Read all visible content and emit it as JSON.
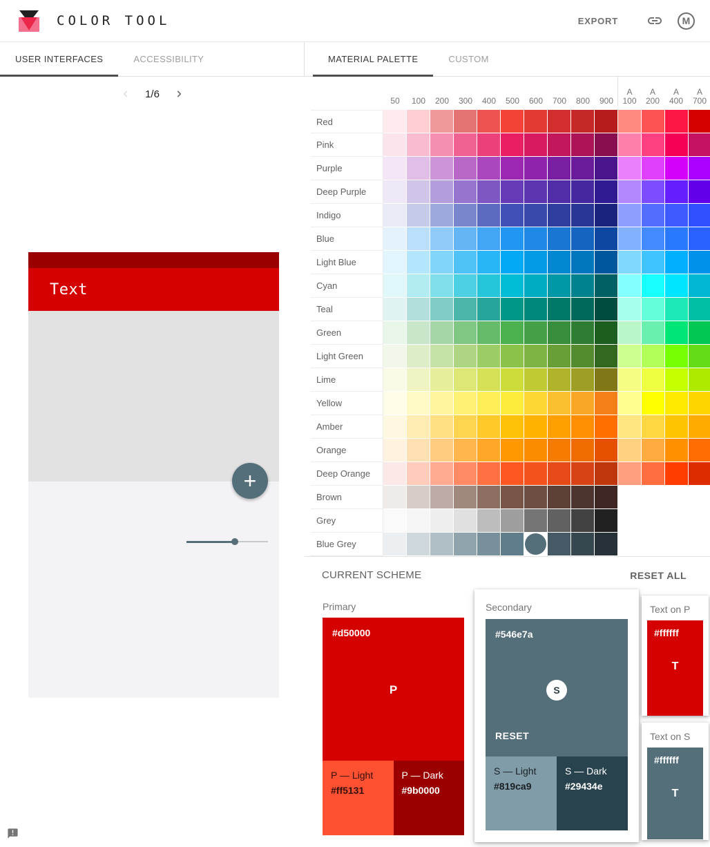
{
  "header": {
    "title": "COLOR TOOL",
    "export_label": "EXPORT",
    "avatar_letter": "M"
  },
  "tabs": {
    "left": [
      {
        "label": "USER INTERFACES",
        "active": true
      },
      {
        "label": "ACCESSIBILITY",
        "active": false
      }
    ],
    "right": [
      {
        "label": "MATERIAL PALETTE",
        "active": true
      },
      {
        "label": "CUSTOM",
        "active": false
      }
    ]
  },
  "preview": {
    "pagination": {
      "current": "1/6",
      "prev_enabled": false,
      "next_enabled": true
    },
    "toolbar_text": "Text",
    "fab_glyph": "+",
    "slider_percent": 59,
    "colors": {
      "status_bar": "#9b0000",
      "app_bar": "#d50000",
      "content_top": "#e2e2e3",
      "content_bottom": "#f3f3f5",
      "fab": "#546e7a",
      "slider": "#546e7a"
    }
  },
  "palette": {
    "columns": [
      "50",
      "100",
      "200",
      "300",
      "400",
      "500",
      "600",
      "700",
      "800",
      "900",
      "A 100",
      "A 200",
      "A 400",
      "A 700"
    ],
    "selected": {
      "row": "Blue Grey",
      "column": "600"
    },
    "rows": [
      {
        "name": "Red",
        "colors": [
          "#ffebee",
          "#ffcdd2",
          "#ef9a9a",
          "#e57373",
          "#ef5350",
          "#f44336",
          "#e53935",
          "#d32f2f",
          "#c62828",
          "#b71c1c",
          "#ff8a80",
          "#ff5252",
          "#ff1744",
          "#d50000"
        ]
      },
      {
        "name": "Pink",
        "colors": [
          "#fce4ec",
          "#f8bbd0",
          "#f48fb1",
          "#f06292",
          "#ec407a",
          "#e91e63",
          "#d81b60",
          "#c2185b",
          "#ad1457",
          "#880e4f",
          "#ff80ab",
          "#ff4081",
          "#f50057",
          "#c51162"
        ]
      },
      {
        "name": "Purple",
        "colors": [
          "#f3e5f5",
          "#e1bee7",
          "#ce93d8",
          "#ba68c8",
          "#ab47bc",
          "#9c27b0",
          "#8e24aa",
          "#7b1fa2",
          "#6a1b9a",
          "#4a148c",
          "#ea80fc",
          "#e040fb",
          "#d500f9",
          "#aa00ff"
        ]
      },
      {
        "name": "Deep Purple",
        "colors": [
          "#ede7f6",
          "#d1c4e9",
          "#b39ddb",
          "#9575cd",
          "#7e57c2",
          "#673ab7",
          "#5e35b1",
          "#512da8",
          "#4527a0",
          "#311b92",
          "#b388ff",
          "#7c4dff",
          "#651fff",
          "#6200ea"
        ]
      },
      {
        "name": "Indigo",
        "colors": [
          "#e8eaf6",
          "#c5cae9",
          "#9fa8da",
          "#7986cb",
          "#5c6bc0",
          "#3f51b5",
          "#3949ab",
          "#303f9f",
          "#283593",
          "#1a237e",
          "#8c9eff",
          "#536dfe",
          "#3d5afe",
          "#304ffe"
        ]
      },
      {
        "name": "Blue",
        "colors": [
          "#e3f2fd",
          "#bbdefb",
          "#90caf9",
          "#64b5f6",
          "#42a5f5",
          "#2196f3",
          "#1e88e5",
          "#1976d2",
          "#1565c0",
          "#0d47a1",
          "#82b1ff",
          "#448aff",
          "#2979ff",
          "#2962ff"
        ]
      },
      {
        "name": "Light Blue",
        "colors": [
          "#e1f5fe",
          "#b3e5fc",
          "#81d4fa",
          "#4fc3f7",
          "#29b6f6",
          "#03a9f4",
          "#039be5",
          "#0288d1",
          "#0277bd",
          "#01579b",
          "#80d8ff",
          "#40c4ff",
          "#00b0ff",
          "#0091ea"
        ]
      },
      {
        "name": "Cyan",
        "colors": [
          "#e0f7fa",
          "#b2ebf2",
          "#80deea",
          "#4dd0e1",
          "#26c6da",
          "#00bcd4",
          "#00acc1",
          "#0097a7",
          "#00838f",
          "#006064",
          "#84ffff",
          "#18ffff",
          "#00e5ff",
          "#00b8d4"
        ]
      },
      {
        "name": "Teal",
        "colors": [
          "#e0f2f1",
          "#b2dfdb",
          "#80cbc4",
          "#4db6ac",
          "#26a69a",
          "#009688",
          "#00897b",
          "#00796b",
          "#00695c",
          "#004d40",
          "#a7ffeb",
          "#64ffda",
          "#1de9b6",
          "#00bfa5"
        ]
      },
      {
        "name": "Green",
        "colors": [
          "#e8f5e9",
          "#c8e6c9",
          "#a5d6a7",
          "#81c784",
          "#66bb6a",
          "#4caf50",
          "#43a047",
          "#388e3c",
          "#2e7d32",
          "#1b5e20",
          "#b9f6ca",
          "#69f0ae",
          "#00e676",
          "#00c853"
        ]
      },
      {
        "name": "Light Green",
        "colors": [
          "#f1f8e9",
          "#dcedc8",
          "#c5e1a5",
          "#aed581",
          "#9ccc65",
          "#8bc34a",
          "#7cb342",
          "#689f38",
          "#558b2f",
          "#33691e",
          "#ccff90",
          "#b2ff59",
          "#76ff03",
          "#64dd17"
        ]
      },
      {
        "name": "Lime",
        "colors": [
          "#f9fbe7",
          "#f0f4c3",
          "#e6ee9c",
          "#dce775",
          "#d4e157",
          "#cddc39",
          "#c0ca33",
          "#afb42b",
          "#9e9d24",
          "#827717",
          "#f4ff81",
          "#eeff41",
          "#c6ff00",
          "#aeea00"
        ]
      },
      {
        "name": "Yellow",
        "colors": [
          "#fffde7",
          "#fff9c4",
          "#fff59d",
          "#fff176",
          "#ffee58",
          "#ffeb3b",
          "#fdd835",
          "#fbc02d",
          "#f9a825",
          "#f57f17",
          "#ffff8d",
          "#ffff00",
          "#ffea00",
          "#ffd600"
        ]
      },
      {
        "name": "Amber",
        "colors": [
          "#fff8e1",
          "#ffecb3",
          "#ffe082",
          "#ffd54f",
          "#ffca28",
          "#ffc107",
          "#ffb300",
          "#ffa000",
          "#ff8f00",
          "#ff6f00",
          "#ffe57f",
          "#ffd740",
          "#ffc400",
          "#ffab00"
        ]
      },
      {
        "name": "Orange",
        "colors": [
          "#fff3e0",
          "#ffe0b2",
          "#ffcc80",
          "#ffb74d",
          "#ffa726",
          "#ff9800",
          "#fb8c00",
          "#f57c00",
          "#ef6c00",
          "#e65100",
          "#ffd180",
          "#ffab40",
          "#ff9100",
          "#ff6d00"
        ]
      },
      {
        "name": "Deep Orange",
        "colors": [
          "#fbe9e7",
          "#ffccbc",
          "#ffab91",
          "#ff8a65",
          "#ff7043",
          "#ff5722",
          "#f4511e",
          "#e64a19",
          "#d84315",
          "#bf360c",
          "#ff9e80",
          "#ff6e40",
          "#ff3d00",
          "#dd2c00"
        ]
      },
      {
        "name": "Brown",
        "colors": [
          "#efebe9",
          "#d7ccc8",
          "#bcaaa4",
          "#a1887f",
          "#8d6e63",
          "#795548",
          "#6d4c41",
          "#5d4037",
          "#4e342e",
          "#3e2723"
        ]
      },
      {
        "name": "Grey",
        "colors": [
          "#fafafa",
          "#f5f5f5",
          "#eeeeee",
          "#e0e0e0",
          "#bdbdbd",
          "#9e9e9e",
          "#757575",
          "#616161",
          "#424242",
          "#212121"
        ]
      },
      {
        "name": "Blue Grey",
        "colors": [
          "#eceff1",
          "#cfd8dc",
          "#b0bec5",
          "#90a4ae",
          "#78909c",
          "#607d8b",
          "#546e7a",
          "#455a64",
          "#37474f",
          "#263238"
        ]
      }
    ]
  },
  "scheme": {
    "title": "CURRENT SCHEME",
    "reset_all": "RESET ALL",
    "primary": {
      "label": "Primary",
      "hex": "#d50000",
      "letter": "P",
      "light": {
        "label": "P — Light",
        "hex": "#ff5131"
      },
      "dark": {
        "label": "P — Dark",
        "hex": "#9b0000"
      }
    },
    "secondary": {
      "label": "Secondary",
      "hex": "#546e7a",
      "letter": "S",
      "reset_label": "RESET",
      "light": {
        "label": "S — Light",
        "hex": "#819ca9"
      },
      "dark": {
        "label": "S — Dark",
        "hex": "#29434e"
      }
    },
    "text_on_p": {
      "label": "Text on P",
      "hex": "#ffffff",
      "letter": "T",
      "bg": "#d50000"
    },
    "text_on_s": {
      "label": "Text on S",
      "hex": "#ffffff",
      "letter": "T",
      "bg": "#546e7a"
    }
  }
}
